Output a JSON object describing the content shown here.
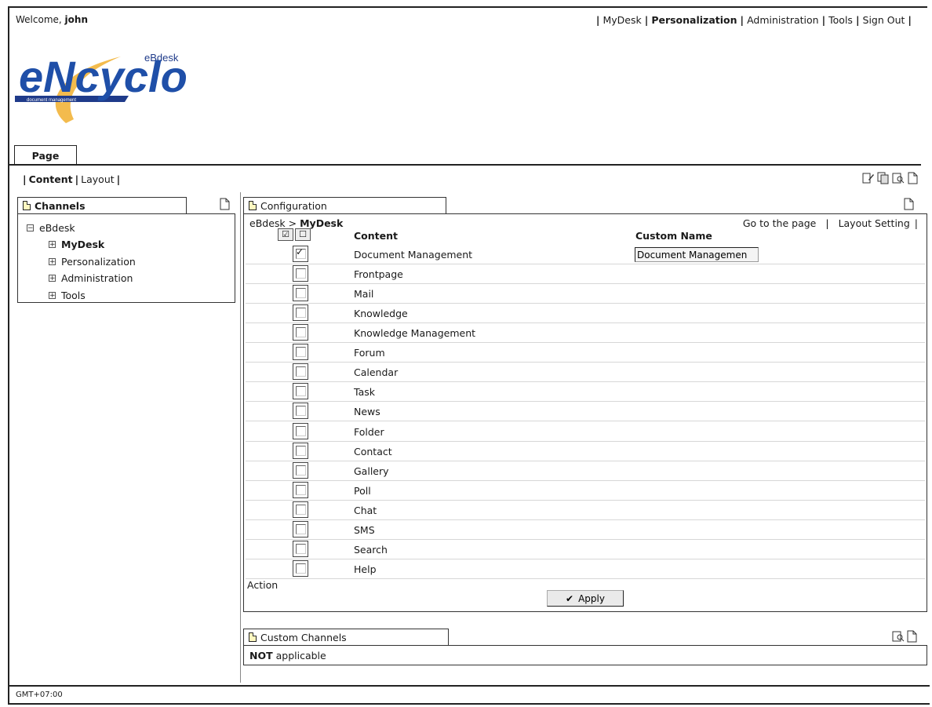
{
  "header": {
    "welcome_prefix": "Welcome,",
    "username": "john",
    "nav": [
      {
        "label": "MyDesk",
        "active": false
      },
      {
        "label": "Personalization",
        "active": true
      },
      {
        "label": "Administration",
        "active": false
      },
      {
        "label": "Tools",
        "active": false
      },
      {
        "label": "Sign Out",
        "active": false
      }
    ]
  },
  "logo": {
    "small_text": "eBdesk",
    "main_text": "eNcyclo",
    "tagline": "document management"
  },
  "tabs": {
    "page_label": "Page"
  },
  "subnav": {
    "content_label": "Content",
    "layout_label": "Layout"
  },
  "channels": {
    "title": "Channels",
    "tree": {
      "root": "eBdesk",
      "children": [
        "MyDesk",
        "Personalization",
        "Administration",
        "Tools"
      ]
    }
  },
  "configuration": {
    "title": "Configuration",
    "breadcrumb_root": "eBdesk",
    "breadcrumb_sep": ">",
    "breadcrumb_current": "MyDesk",
    "link_goto": "Go to the page",
    "link_layout": "Layout Setting",
    "col_content": "Content",
    "col_custom": "Custom Name",
    "items": [
      {
        "label": "Document Management",
        "checked": true
      },
      {
        "label": "Frontpage",
        "checked": false
      },
      {
        "label": "Mail",
        "checked": false
      },
      {
        "label": "Knowledge",
        "checked": false
      },
      {
        "label": "Knowledge Management",
        "checked": false
      },
      {
        "label": "Forum",
        "checked": false
      },
      {
        "label": "Calendar",
        "checked": false
      },
      {
        "label": "Task",
        "checked": false
      },
      {
        "label": "News",
        "checked": false
      },
      {
        "label": "Folder",
        "checked": false
      },
      {
        "label": "Contact",
        "checked": false
      },
      {
        "label": "Gallery",
        "checked": false
      },
      {
        "label": "Poll",
        "checked": false
      },
      {
        "label": "Chat",
        "checked": false
      },
      {
        "label": "SMS",
        "checked": false
      },
      {
        "label": "Search",
        "checked": false
      },
      {
        "label": "Help",
        "checked": false
      }
    ],
    "custom_name_value": "Document Managemen",
    "action_label": "Action",
    "apply_label": "Apply"
  },
  "custom_channels": {
    "title": "Custom Channels",
    "text_bold": "NOT",
    "text_rest": "applicable"
  },
  "footer": {
    "timezone": "GMT+07:00"
  }
}
